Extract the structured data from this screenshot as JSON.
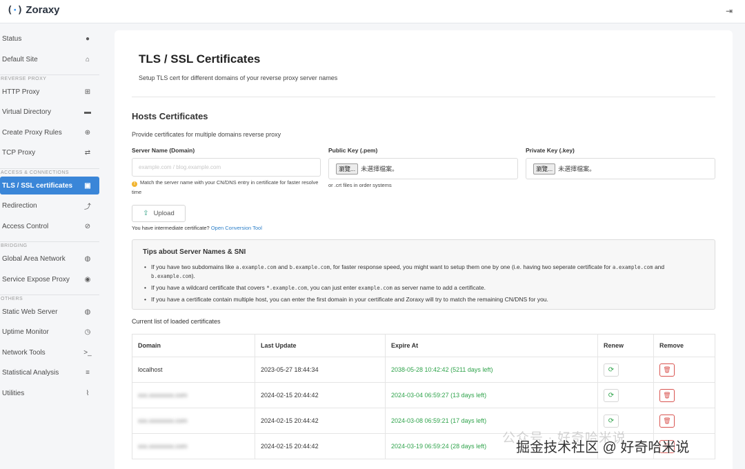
{
  "app": {
    "name": "Zoraxy",
    "logo_mark_left": "(",
    "logo_mark_mid": "·",
    "logo_mark_right": ")"
  },
  "header": {
    "logout_icon": "logout-icon"
  },
  "sidebar": {
    "items": [
      {
        "label": "Status",
        "icon": "info-circle-icon",
        "glyph": "●"
      },
      {
        "label": "Default Site",
        "icon": "home-icon",
        "glyph": "⌂"
      },
      {
        "label": "HTTP Proxy",
        "icon": "sitemap-icon",
        "glyph": "⊞"
      },
      {
        "label": "Virtual Directory",
        "icon": "folder-icon",
        "glyph": "▬"
      },
      {
        "label": "Create Proxy Rules",
        "icon": "plus-square-icon",
        "glyph": "⊕"
      },
      {
        "label": "TCP Proxy",
        "icon": "exchange-icon",
        "glyph": "⇄"
      },
      {
        "label": "TLS / SSL certificates",
        "icon": "lock-icon",
        "glyph": "🔒"
      },
      {
        "label": "Redirection",
        "icon": "level-up-icon",
        "glyph": "⤴"
      },
      {
        "label": "Access Control",
        "icon": "ban-icon",
        "glyph": "⊘"
      },
      {
        "label": "Global Area Network",
        "icon": "globe-icon",
        "glyph": "◍"
      },
      {
        "label": "Service Expose Proxy",
        "icon": "podcast-icon",
        "glyph": "◉"
      },
      {
        "label": "Static Web Server",
        "icon": "globe-icon",
        "glyph": "◍"
      },
      {
        "label": "Uptime Monitor",
        "icon": "clock-icon",
        "glyph": "◷"
      },
      {
        "label": "Network Tools",
        "icon": "terminal-icon",
        "glyph": ">_"
      },
      {
        "label": "Statistical Analysis",
        "icon": "database-icon",
        "glyph": "≡"
      },
      {
        "label": "Utilities",
        "icon": "paperclip-icon",
        "glyph": "⌇"
      }
    ],
    "groups": [
      "REVERSE PROXY",
      "ACCESS & CONNECTIONS",
      "BRIDGING",
      "OTHERS"
    ]
  },
  "main": {
    "title": "TLS / SSL Certificates",
    "subtitle": "Setup TLS cert for different domains of your reverse proxy server names",
    "hosts": {
      "title": "Hosts Certificates",
      "subtitle": "Provide certificates for multiple domains reverse proxy",
      "server_name_label": "Server Name (Domain)",
      "server_name_placeholder": "example.com / blog.example.com",
      "server_name_hint": "Match the server name with your CN/DNS entry in certificate for faster resolve time",
      "public_key_label": "Public Key (.pem)",
      "private_key_label": "Private Key (.key)",
      "file_button": "瀏覽...",
      "file_none": "未選擇檔案。",
      "public_key_hint": "or .crt files in order systems",
      "upload_label": "Upload",
      "intermediate_text": "You have intermediate certificate?",
      "intermediate_link": "Open Conversion Tool"
    },
    "tips": {
      "title": "Tips about Server Names & SNI",
      "t1_a": "If you have two subdomains like",
      "t1_code1": "a.example.com",
      "t1_b": "and",
      "t1_code2": "b.example.com",
      "t1_c": ", for faster response speed, you might want to setup them one by one (i.e. having two seperate certificate for",
      "t1_code3": "a.example.com",
      "t1_d": "and",
      "t1_code4": "b.example.com",
      "t1_e": ").",
      "t2_a": "If you have a wildcard certificate that covers",
      "t2_code1": "*.example.com",
      "t2_b": ", you can just enter",
      "t2_code2": "example.com",
      "t2_c": "as server name to add a certificate.",
      "t3": "If you have a certificate contain multiple host, you can enter the first domain in your certificate and Zoraxy will try to match the remaining CN/DNS for you."
    },
    "list_title": "Current list of loaded certificates",
    "table": {
      "headers": [
        "Domain",
        "Last Update",
        "Expire At",
        "Renew",
        "Remove"
      ],
      "rows": [
        {
          "domain": "localhost",
          "last_update": "2023-05-27 18:44:34",
          "expire": "2038-05-28 10:42:42 (5211 days left)",
          "blurred": false
        },
        {
          "domain": "xxx.xxxxxxxx.com",
          "last_update": "2024-02-15 20:44:42",
          "expire": "2024-03-04 06:59:27 (13 days left)",
          "blurred": true
        },
        {
          "domain": "xxx.xxxxxxxx.com",
          "last_update": "2024-02-15 20:44:42",
          "expire": "2024-03-08 06:59:21 (17 days left)",
          "blurred": true
        },
        {
          "domain": "xxx.xxxxxxxx.com",
          "last_update": "2024-02-15 20:44:42",
          "expire": "2024-03-19 06:59:24 (28 days left)",
          "blurred": true
        }
      ]
    }
  },
  "watermark": {
    "top": "公众号 · 好奇哈米说",
    "main": "掘金技术社区 @ 好奇哈米说"
  }
}
